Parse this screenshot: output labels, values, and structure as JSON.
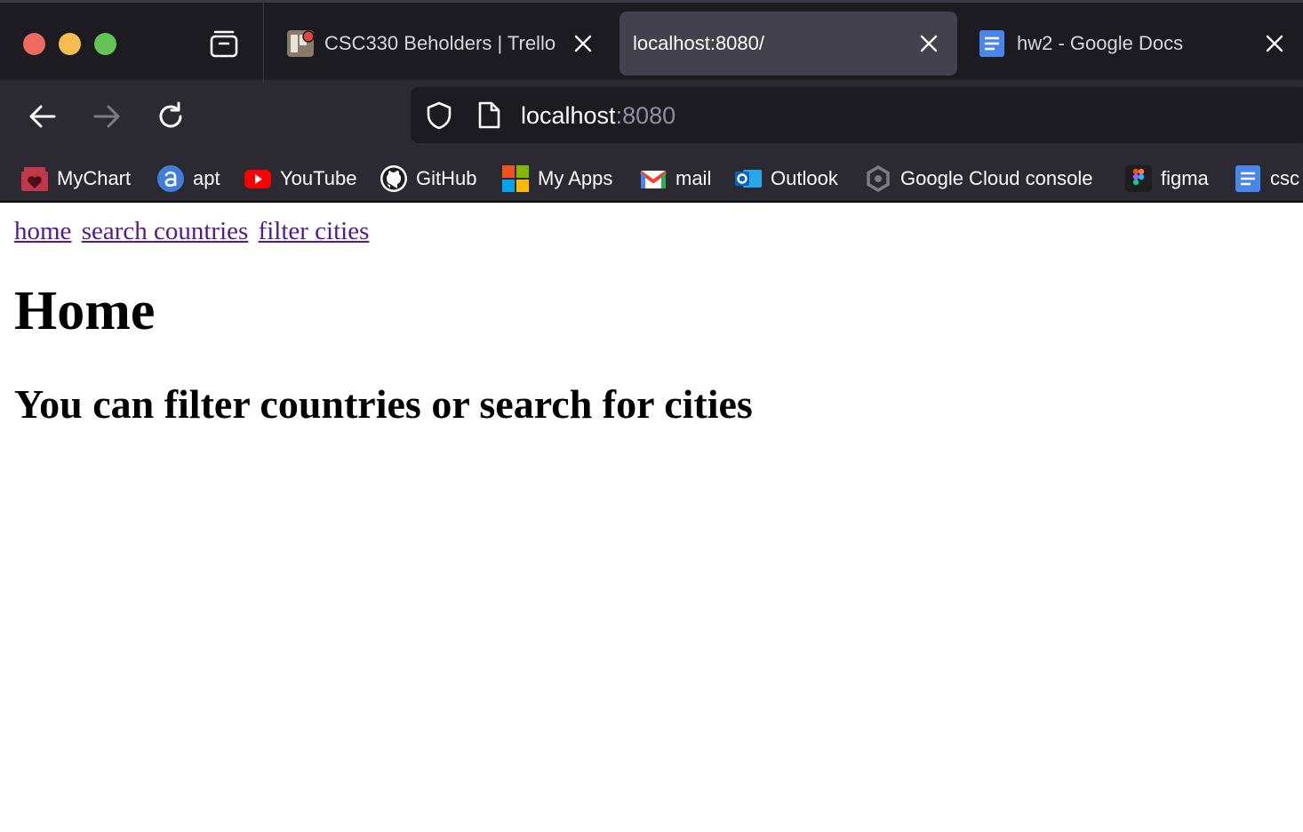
{
  "browser": {
    "tabs": [
      {
        "title": "CSC330 Beholders | Trello",
        "icon": "trello-board-icon",
        "active": false
      },
      {
        "title": "localhost:8080/",
        "icon": "",
        "active": true
      },
      {
        "title": "hw2 - Google Docs",
        "icon": "google-docs-icon",
        "active": false
      }
    ],
    "url": {
      "host": "localhost",
      "port": ":8080"
    },
    "bookmarks": [
      {
        "label": "MyChart",
        "icon": "mychart-icon"
      },
      {
        "label": "apt",
        "icon": "apt-icon"
      },
      {
        "label": "YouTube",
        "icon": "youtube-icon"
      },
      {
        "label": "GitHub",
        "icon": "github-icon"
      },
      {
        "label": "My Apps",
        "icon": "microsoft-icon"
      },
      {
        "label": "mail",
        "icon": "gmail-icon"
      },
      {
        "label": "Outlook",
        "icon": "outlook-icon"
      },
      {
        "label": "Google Cloud console",
        "icon": "google-cloud-icon"
      },
      {
        "label": "figma",
        "icon": "figma-icon"
      },
      {
        "label": "csc",
        "icon": "google-docs-icon"
      }
    ],
    "colors": {
      "tabbar": "#1c1b22",
      "toolbar": "#2b2a33",
      "active_tab": "#42414d",
      "link_visited": "#551a8b"
    }
  },
  "page": {
    "nav": {
      "home": "home",
      "search": "search countries",
      "filter": "filter cities"
    },
    "heading": "Home",
    "subheading": "You can filter countries or search for cities"
  }
}
